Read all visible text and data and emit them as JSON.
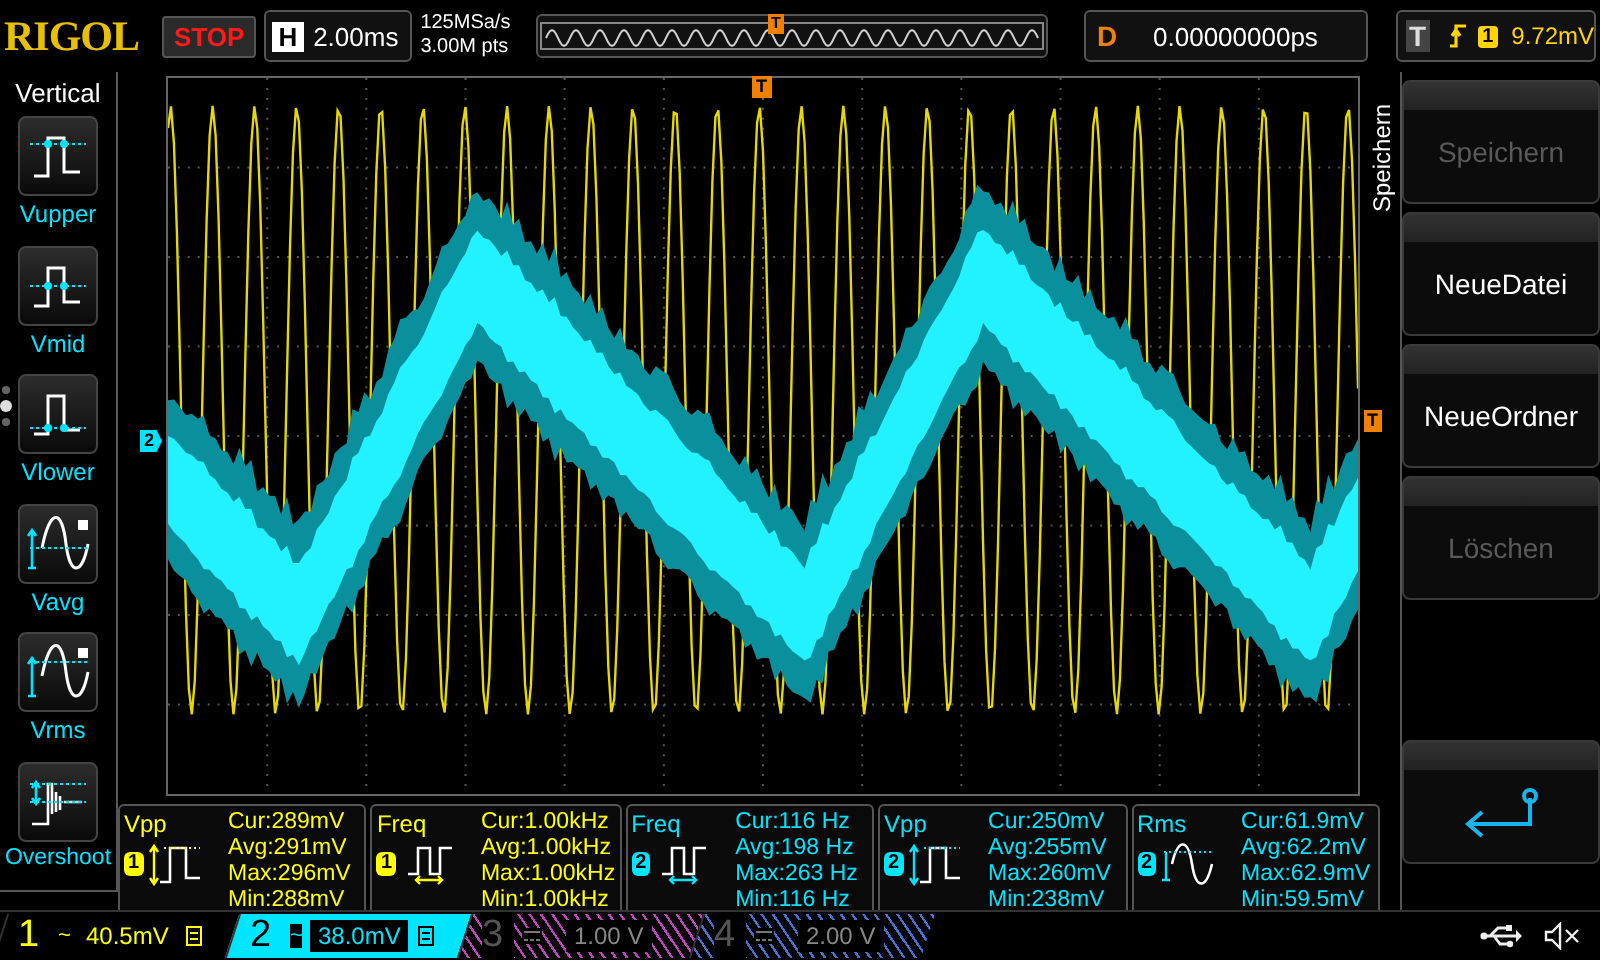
{
  "top_bar": {
    "logo": "RIGOL",
    "run_state": "STOP",
    "horizontal": {
      "label": "H",
      "value": "2.00ms"
    },
    "sample_rate": "125MSa/s",
    "memory_depth": "3.00M pts",
    "trigger_position_marker": "T",
    "delay": {
      "label": "D",
      "value": "0.00000000ps"
    },
    "trigger": {
      "label": "T",
      "source": "1",
      "level": "9.72mV"
    }
  },
  "sidebar": {
    "title": "Vertical",
    "items": [
      {
        "label": "Vupper",
        "kind": "upper"
      },
      {
        "label": "Vmid",
        "kind": "mid"
      },
      {
        "label": "Vlower",
        "kind": "lower"
      },
      {
        "label": "Vavg",
        "kind": "avg"
      },
      {
        "label": "Vrms",
        "kind": "rms"
      },
      {
        "label": "Overshoot",
        "kind": "overshoot"
      }
    ],
    "pages": [
      {
        "selected": false
      },
      {
        "selected": true
      },
      {
        "selected": false
      }
    ]
  },
  "plot": {
    "channel_marker": "2",
    "trigger_level_marker": "T",
    "trigger_time_marker": "T"
  },
  "softkeys": {
    "title": "Speichern",
    "keys": [
      {
        "kind": "text",
        "label": "Speichern",
        "disabled": true
      },
      {
        "kind": "text",
        "label": "NeueDatei",
        "disabled": false
      },
      {
        "kind": "text",
        "label": "NeueOrdner",
        "disabled": false
      },
      {
        "kind": "text",
        "label": "Löschen",
        "disabled": true
      },
      {
        "kind": "spacer"
      },
      {
        "kind": "return"
      }
    ]
  },
  "measurements": [
    {
      "name": "Vpp",
      "channel": "1",
      "color": "#ffff00",
      "kind": "pulse",
      "cur": "Cur:289mV",
      "avg": "Avg:291mV",
      "max": "Max:296mV",
      "min": "Min:288mV"
    },
    {
      "name": "Freq",
      "channel": "1",
      "color": "#ffff00",
      "kind": "freq",
      "cur": "Cur:1.00kHz",
      "avg": "Avg:1.00kHz",
      "max": "Max:1.00kHz",
      "min": "Min:1.00kHz"
    },
    {
      "name": "Freq",
      "channel": "2",
      "color": "#00e5ff",
      "kind": "freq",
      "cur": "Cur:116 Hz",
      "avg": "Avg:198 Hz",
      "max": "Max:263 Hz",
      "min": "Min:116 Hz"
    },
    {
      "name": "Vpp",
      "channel": "2",
      "color": "#00e5ff",
      "kind": "pulse",
      "cur": "Cur:250mV",
      "avg": "Avg:255mV",
      "max": "Max:260mV",
      "min": "Min:238mV"
    },
    {
      "name": "Rms",
      "channel": "2",
      "color": "#00e5ff",
      "kind": "sine",
      "cur": "Cur:61.9mV",
      "avg": "Avg:62.2mV",
      "max": "Max:62.9mV",
      "min": "Min:59.5mV"
    }
  ],
  "channels": [
    {
      "number": "1",
      "coupling": "~",
      "scale": "40.5mV",
      "on": true,
      "selected": false,
      "color": "#ffff00"
    },
    {
      "number": "2",
      "coupling": "~",
      "scale": "38.0mV",
      "on": true,
      "selected": true,
      "color": "#00e5ff"
    },
    {
      "number": "3",
      "scale": "1.00 V",
      "on": false,
      "selected": false,
      "color": "#c040c0"
    },
    {
      "number": "4",
      "scale": "2.00 V",
      "on": false,
      "selected": false,
      "color": "#4070d0"
    }
  ]
}
